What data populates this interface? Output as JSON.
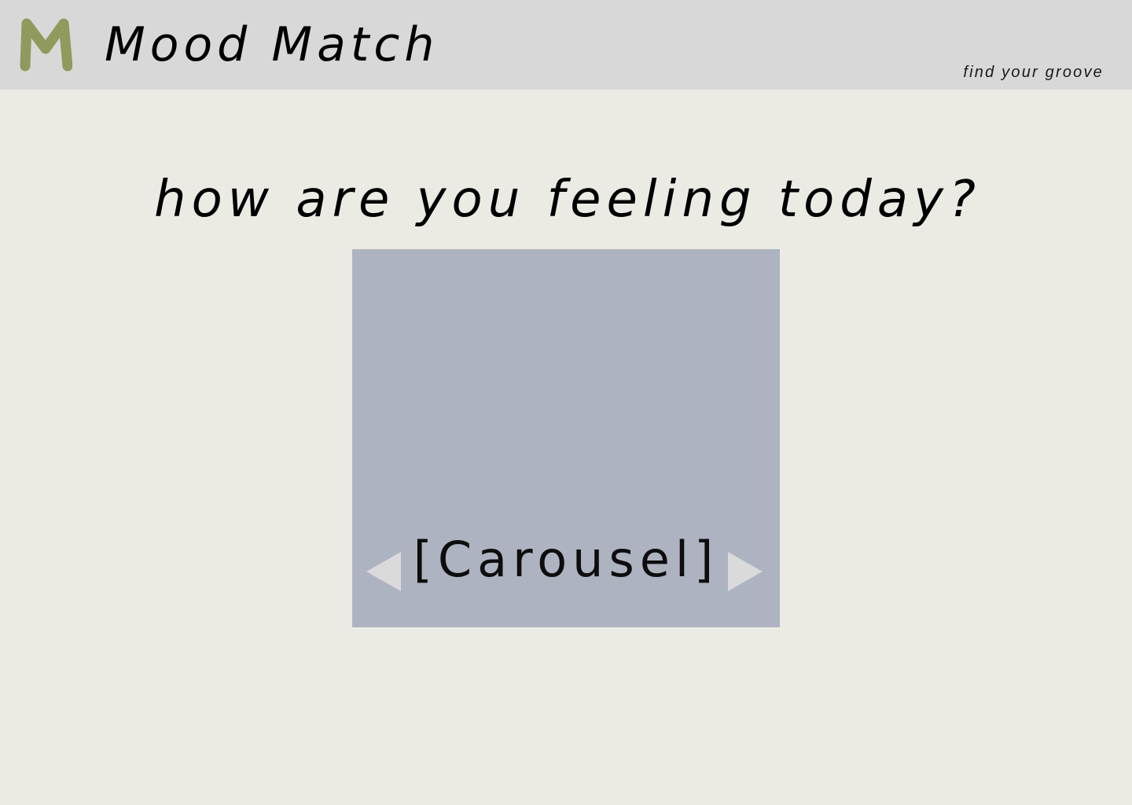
{
  "header": {
    "logo_letter": "M",
    "title": "Mood Match",
    "tagline": "find your groove"
  },
  "main": {
    "question": "how are you feeling today?",
    "carousel": {
      "label": "[Carousel]",
      "prev_icon": "triangle-left-icon",
      "next_icon": "triangle-right-icon"
    }
  },
  "colors": {
    "background": "#ebebe4",
    "header_bg": "#d8d8d9",
    "logo": "#8f9a5c",
    "carousel_bg": "#adb3c0",
    "arrow": "#dadadb",
    "text": "#000000"
  }
}
